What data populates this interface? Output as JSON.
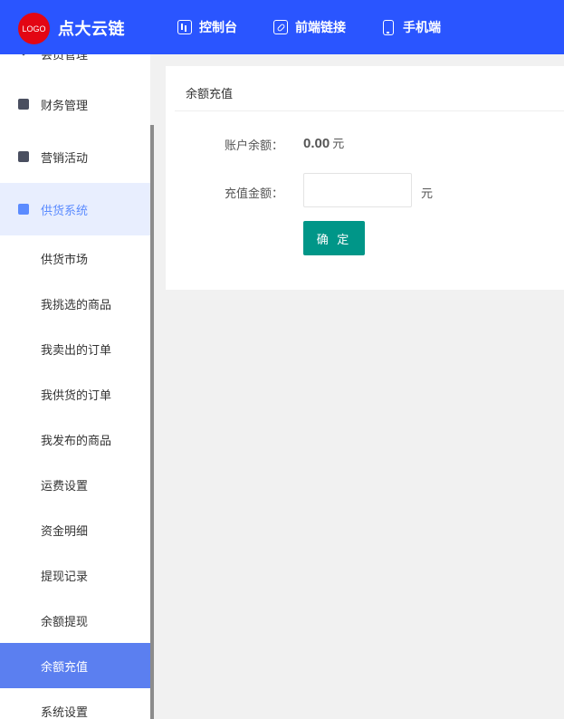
{
  "brand": {
    "logo_text": "LOGO",
    "name": "点大云链"
  },
  "topnav": [
    {
      "label": "控制台",
      "icon": "dashboard-icon"
    },
    {
      "label": "前端链接",
      "icon": "link-icon"
    },
    {
      "label": "手机端",
      "icon": "mobile-icon"
    }
  ],
  "sidebar": {
    "partial_top": "会员管理",
    "parents": [
      {
        "label": "财务管理",
        "icon": "finance-icon"
      },
      {
        "label": "营销活动",
        "icon": "marketing-icon"
      },
      {
        "label": "供货系统",
        "icon": "supply-truck-icon",
        "active": true
      }
    ],
    "subitems": [
      "供货市场",
      "我挑选的商品",
      "我卖出的订单",
      "我供货的订单",
      "我发布的商品",
      "运费设置",
      "资金明细",
      "提现记录",
      "余额提现",
      "余额充值",
      "系统设置"
    ],
    "selected_subitem": "余额充值"
  },
  "card": {
    "title": "余额充值",
    "balance_label": "账户余额：",
    "balance_value": "0.00",
    "balance_unit": "元",
    "amount_label": "充值金额：",
    "amount_value": "",
    "amount_unit": "元",
    "confirm_label": "确 定"
  },
  "colors": {
    "topbar": "#2a55ff",
    "active_menu_bg": "#e8eefe",
    "selected_menu_bg": "#5b7ff0",
    "confirm_button": "#009688"
  }
}
